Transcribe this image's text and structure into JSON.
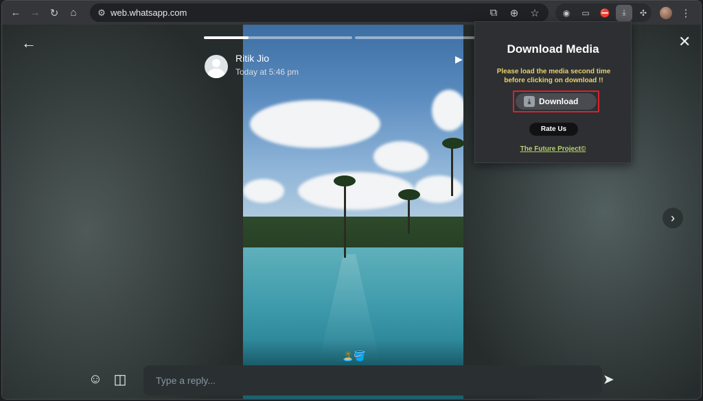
{
  "browser": {
    "url": "web.whatsapp.com",
    "icons": {
      "back": "arrow-left-icon",
      "forward": "arrow-right-icon",
      "reload": "reload-icon",
      "home": "home-icon"
    }
  },
  "status": {
    "poster_name": "Ritik Jio",
    "poster_time": "Today at 5:46 pm",
    "caption": "🏝️🪣",
    "progress": [
      0.3,
      0,
      0
    ],
    "reply_placeholder": "Type a reply..."
  },
  "extension_popup": {
    "title": "Download Media",
    "warning_line1": "Please load the media second time",
    "warning_line2": "before clicking on download !!",
    "download_label": "Download",
    "rate_label": "Rate Us",
    "footer_link": "The Future Project©"
  },
  "colors": {
    "highlight": "#e0202a",
    "warning": "#e8d26a",
    "link": "#b7d36b"
  }
}
